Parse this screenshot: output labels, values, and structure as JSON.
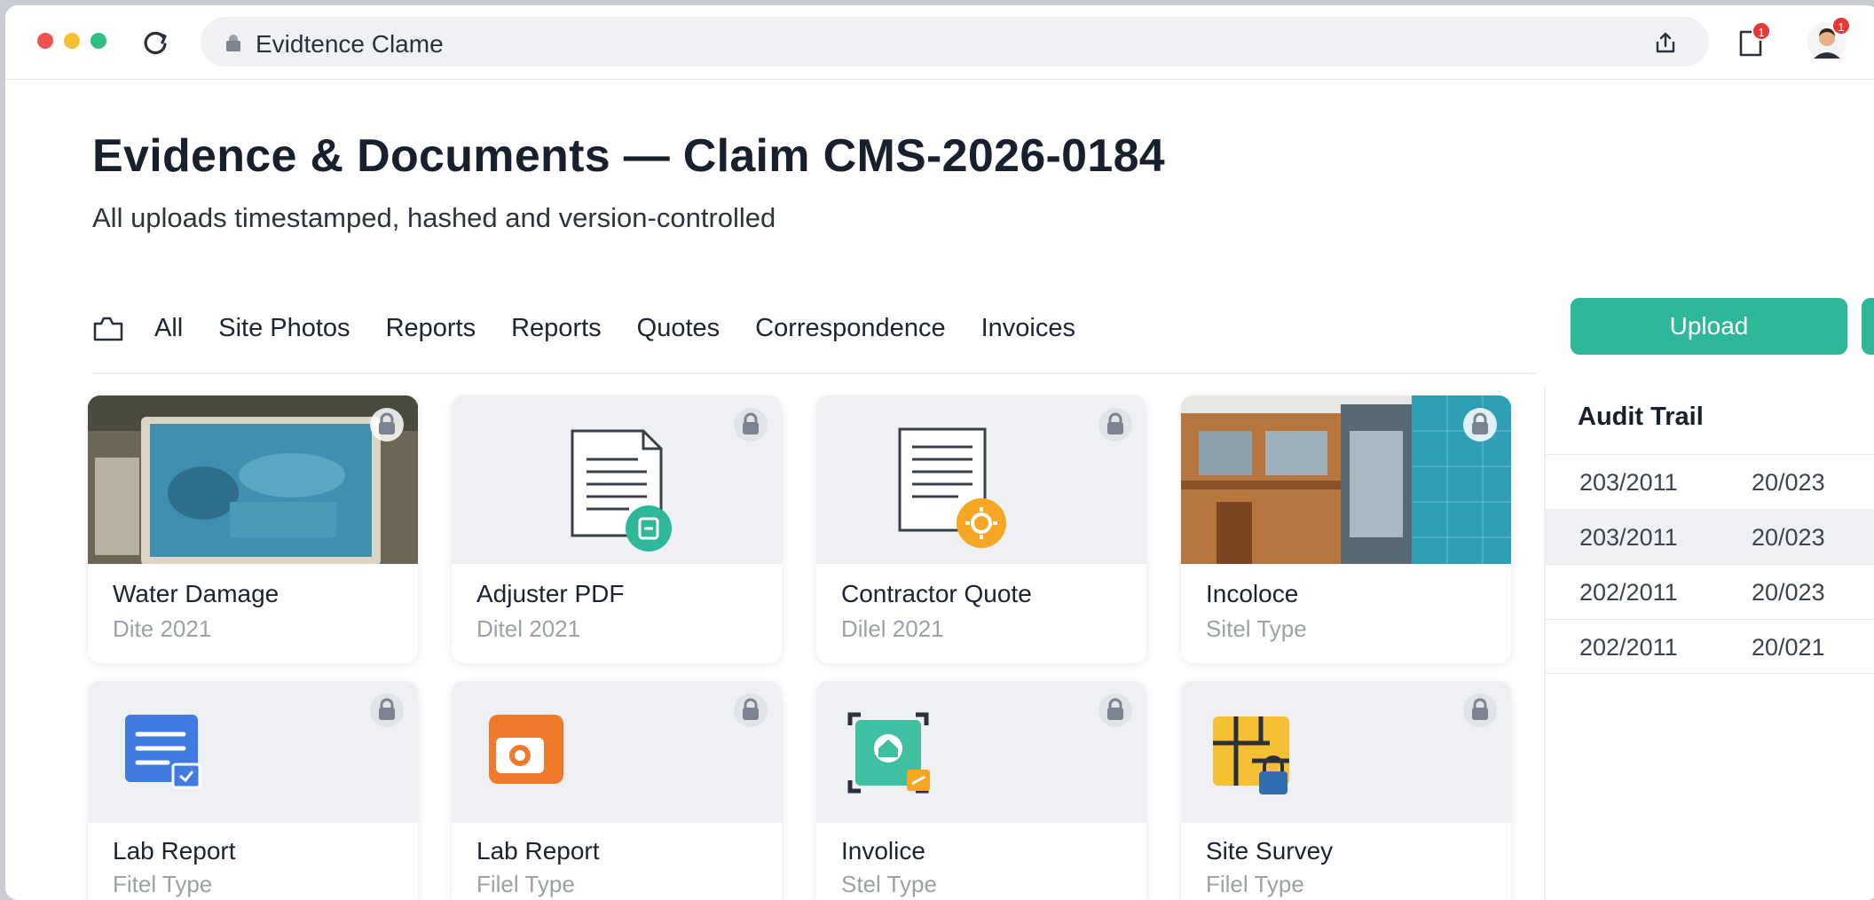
{
  "browser": {
    "url_text": "Evidtence Clame",
    "notif_badge": "1",
    "avatar_badge": "1"
  },
  "header": {
    "title": "Evidence & Documents — Claim CMS-2026-0184",
    "subtitle": "All uploads timestamped, hashed and version-controlled"
  },
  "tabs": [
    "All",
    "Site Photos",
    "Reports",
    "Reports",
    "Quotes",
    "Correspondence",
    "Invoices"
  ],
  "upload_label": "Upload",
  "cards": [
    {
      "name": "Water Damage",
      "meta": "Dite 2021",
      "icon": "water-damage-photo"
    },
    {
      "name": "Adjuster PDF",
      "meta": "Ditel 2021",
      "icon": "document-icon"
    },
    {
      "name": "Contractor Quote",
      "meta": "Dilel 2021",
      "icon": "document-gear-icon"
    },
    {
      "name": "Incoloce",
      "meta": "Sitel Type",
      "icon": "building-interior-photo"
    },
    {
      "name": "Lab Report",
      "meta": "Fitel Type",
      "icon": "report-doc-icon"
    },
    {
      "name": "Lab Report",
      "meta": "Filel Type",
      "icon": "camera-icon"
    },
    {
      "name": "Involice",
      "meta": "Stel Type",
      "icon": "scan-invoice-icon"
    },
    {
      "name": "Site Survey",
      "meta": "Filel Type",
      "icon": "survey-map-lock-icon"
    }
  ],
  "audit": {
    "title": "Audit Trail",
    "rows": [
      [
        "203/2011",
        "20/023"
      ],
      [
        "203/2011",
        "20/023"
      ],
      [
        "202/2011",
        "20/023"
      ],
      [
        "202/2011",
        "20/021"
      ]
    ]
  },
  "colors": {
    "accent": "#2fb79a",
    "dot_red": "#ef5350",
    "dot_yellow": "#f5c034",
    "dot_green": "#2dbd85"
  }
}
